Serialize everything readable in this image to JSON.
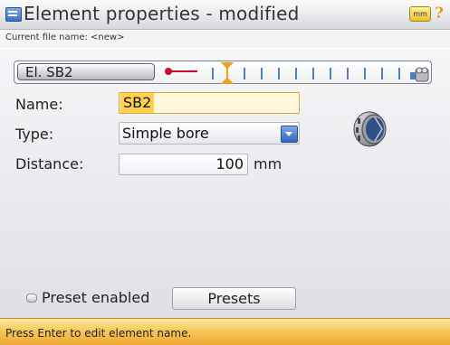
{
  "window": {
    "title": "Element properties - modified",
    "unit_badge": "mm",
    "help_glyph": "?"
  },
  "file": {
    "label": "Current file name: <new>"
  },
  "element_selector": {
    "selected": "El. SB2",
    "icon": "line-pin-icon",
    "end_icon": "machine-icon"
  },
  "form": {
    "name_label": "Name:",
    "name_value": "SB2",
    "type_label": "Type:",
    "type_value": "Simple bore",
    "distance_label": "Distance:",
    "distance_value": "100",
    "distance_unit": "mm"
  },
  "preview": {
    "icon": "simple-bore-icon"
  },
  "presets": {
    "checkbox_label": "Preset enabled",
    "checked": false,
    "button_label": "Presets"
  },
  "status": {
    "message": "Press Enter to edit element name."
  },
  "colors": {
    "highlight": "#ffd24a",
    "accent": "#f0a020",
    "status_bar": "#f7c85a"
  }
}
